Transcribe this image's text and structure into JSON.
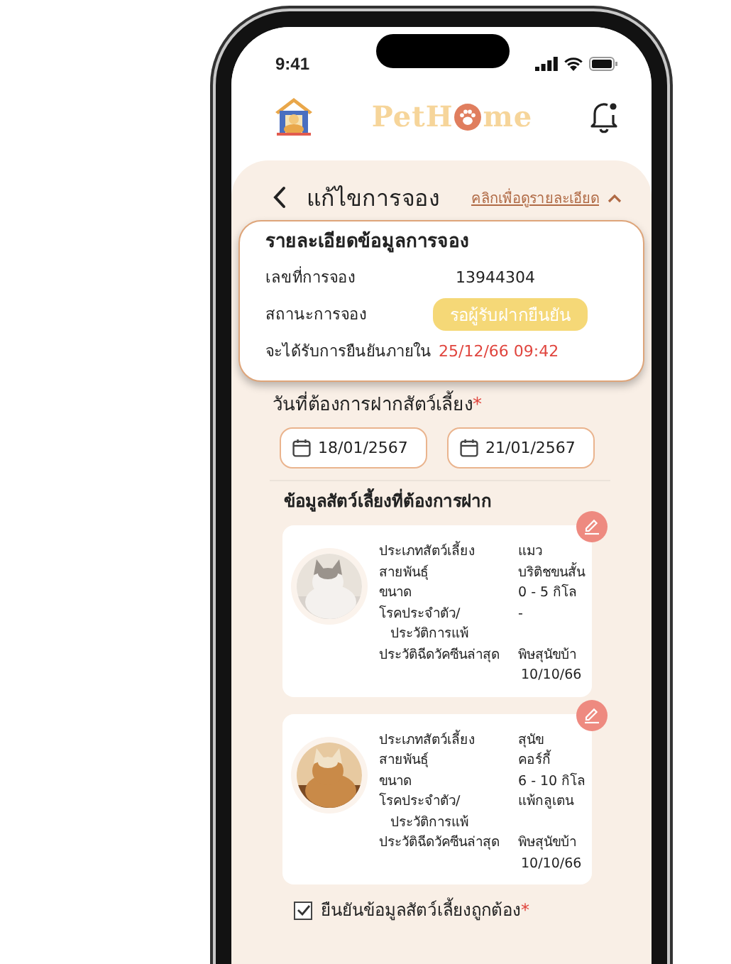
{
  "status_bar": {
    "time": "9:41"
  },
  "header": {
    "logo_before": "PetH",
    "logo_after": "me",
    "notification": true
  },
  "page": {
    "title": "แก้ไขการจอง",
    "details_link": "คลิกเพื่อดูรายละเอียด",
    "expanded": true
  },
  "booking": {
    "heading": "รายละเอียดข้อมูลการจอง",
    "rows": [
      {
        "kind": "text",
        "label": "เลขที่การจอง",
        "value": "13944304"
      },
      {
        "kind": "badge",
        "label": "สถานะการจอง",
        "value": "รอผู้รับฝากยืนยัน"
      },
      {
        "kind": "alert",
        "label": "จะได้รับการยืนยันภายใน",
        "value": "25/12/66 09:42"
      }
    ]
  },
  "dates": {
    "label": "วันที่ต้องการฝากสัตว์เลี้ยง",
    "required_mark": "*",
    "values": [
      "18/01/2567",
      "21/01/2567"
    ]
  },
  "pets_heading": "ข้อมูลสัตว์เลี้ยงที่ต้องการฝาก",
  "pets": [
    {
      "kind": "picture",
      "fields": [
        {
          "label": "ประเภทสัตว์เลี้ยง",
          "value": "แมว"
        },
        {
          "label": "สายพันธุ์",
          "value": "บริติชขนสั้น"
        },
        {
          "label": "ขนาด",
          "value": "0 - 5 กิโล"
        },
        {
          "label": "โรคประจำตัว/\nประวัติการแพ้",
          "value": "-"
        },
        {
          "label": "ประวัติฉีดวัคซีนล่าสุด",
          "value": "พิษสุนัขบ้า\n10/10/66"
        }
      ]
    },
    {
      "kind": "picture",
      "fields": [
        {
          "label": "ประเภทสัตว์เลี้ยง",
          "value": "สุนัข"
        },
        {
          "label": "สายพันธุ์",
          "value": "คอร์กี้"
        },
        {
          "label": "ขนาด",
          "value": "6 - 10 กิโล"
        },
        {
          "label": "โรคประจำตัว/\nประวัติการแพ้",
          "value": "แพ้กลูเตน"
        },
        {
          "label": "ประวัติฉีดวัคซีนล่าสุด",
          "value": "พิษสุนัขบ้า\n10/10/66"
        }
      ]
    }
  ],
  "confirm": {
    "label": "ยืนยันข้อมูลสัตว์เลี้ยงถูกต้อง",
    "checked": true,
    "required_mark": "*"
  }
}
